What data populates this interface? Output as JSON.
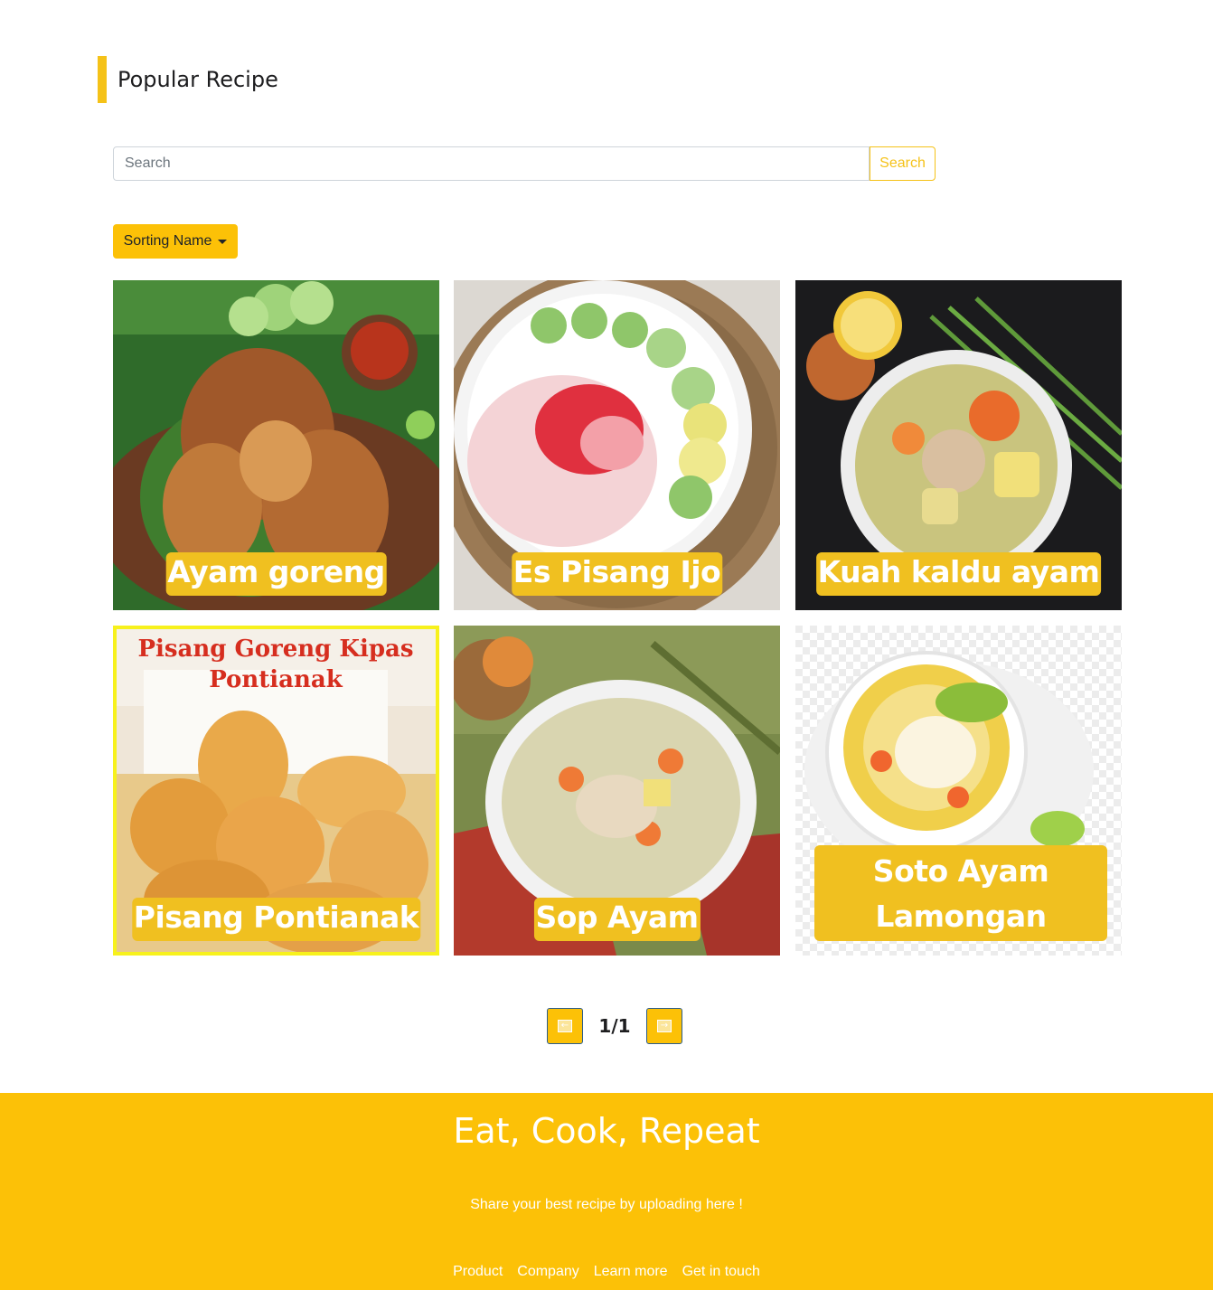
{
  "header": {
    "title": "Popular Recipe"
  },
  "search": {
    "placeholder": "Search",
    "button_label": "Search"
  },
  "sort": {
    "label": "Sorting Name"
  },
  "recipes": [
    {
      "name": "Ayam goreng"
    },
    {
      "name": "Es Pisang Ijo"
    },
    {
      "name": "Kuah kaldu ayam"
    },
    {
      "name": "Pisang Pontianak",
      "image_text": [
        "Pisang Goreng Kipas",
        "Pontianak"
      ]
    },
    {
      "name": "Sop Ayam"
    },
    {
      "name": "Soto Ayam Lamongan"
    }
  ],
  "pagination": {
    "text": "1/1",
    "prev_icon": "arrow-left-icon",
    "next_icon": "arrow-right-icon"
  },
  "footer": {
    "title": "Eat, Cook, Repeat",
    "subtitle": "Share your best recipe by uploading here !",
    "links": [
      "Product",
      "Company",
      "Learn more",
      "Get in touch"
    ]
  },
  "colors": {
    "accent": "#fcc107",
    "label_bg": "#f0c020",
    "highlight": "#f7f11c"
  }
}
